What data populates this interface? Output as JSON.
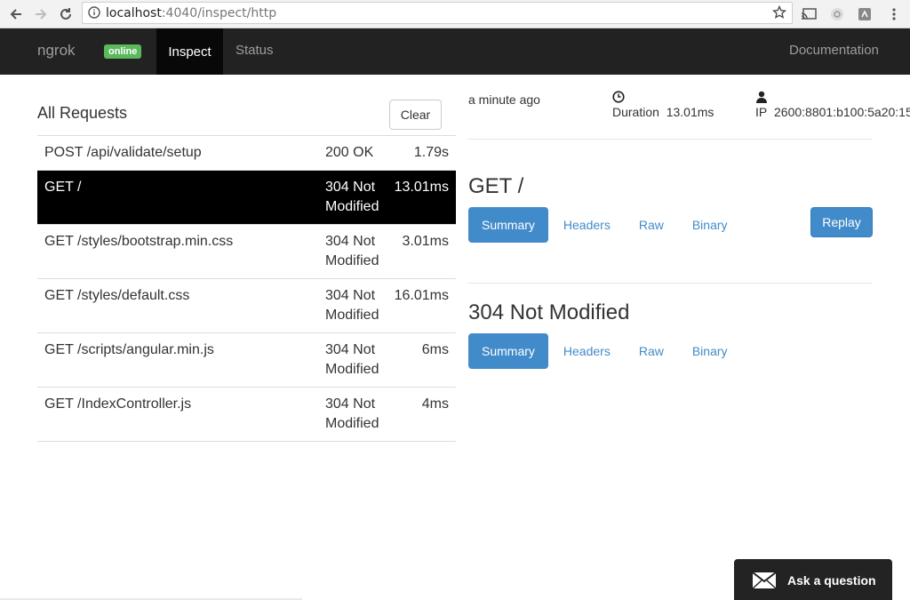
{
  "browser": {
    "url_host": "localhost",
    "url_path": ":4040/inspect/http"
  },
  "navbar": {
    "brand": "ngrok",
    "status_badge": "online",
    "tabs": [
      {
        "label": "Inspect",
        "active": true
      },
      {
        "label": "Status",
        "active": false
      }
    ],
    "documentation": "Documentation"
  },
  "requests": {
    "title": "All Requests",
    "clear_label": "Clear",
    "rows": [
      {
        "path": "POST /api/validate/setup",
        "status": "200 OK",
        "duration": "1.79s",
        "selected": false
      },
      {
        "path": "GET /",
        "status": "304 Not Modified",
        "duration": "13.01ms",
        "selected": true
      },
      {
        "path": "GET /styles/bootstrap.min.css",
        "status": "304 Not Modified",
        "duration": "3.01ms",
        "selected": false
      },
      {
        "path": "GET /styles/default.css",
        "status": "304 Not Modified",
        "duration": "16.01ms",
        "selected": false
      },
      {
        "path": "GET /scripts/angular.min.js",
        "status": "304 Not Modified",
        "duration": "6ms",
        "selected": false
      },
      {
        "path": "GET /IndexController.js",
        "status": "304 Not Modified",
        "duration": "4ms",
        "selected": false
      }
    ]
  },
  "detail": {
    "time_ago": "a minute ago",
    "duration_label": "Duration",
    "duration_value": "13.01ms",
    "ip_label": "IP",
    "ip_value": "2600:8801:b100:5a20:15",
    "request_title": "GET /",
    "request_tabs": [
      "Summary",
      "Headers",
      "Raw",
      "Binary"
    ],
    "replay_label": "Replay",
    "response_title": "304 Not Modified",
    "response_tabs": [
      "Summary",
      "Headers",
      "Raw",
      "Binary"
    ]
  },
  "widget": {
    "label": "Ask a question"
  },
  "colors": {
    "navbar_bg": "#222222",
    "online_badge": "#5cb85c",
    "primary": "#428bca",
    "selected_row": "#000000"
  }
}
